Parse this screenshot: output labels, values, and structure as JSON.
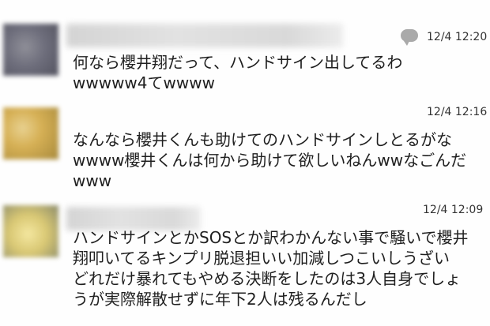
{
  "comments": [
    {
      "time": "12/4 12:20",
      "text": "何なら櫻井翔だって、ハンドサイン出してるわ\nwwwww4てwwww",
      "has_reply_icon": true
    },
    {
      "time": "12/4 12:16",
      "text": "なんなら櫻井くんも助けてのハンドサインしとるがな\nwwww櫻井くんは何から助けて欲しいねんwwなごんだ\nwww",
      "has_reply_icon": false
    },
    {
      "time": "12/4 12:09",
      "text": "ハンドサインとかSOSとか訳わかんない事で騒いで櫻井\n翔叩いてるキンプリ脱退担いい加減しつこいしうざい\nどれだけ暴れてもやめる決断をしたのは3人自身でしょ\nうが実際解散せずに年下2人は残るんだし",
      "has_reply_icon": false
    }
  ],
  "icons": {
    "reply": "speech-bubble-icon"
  }
}
